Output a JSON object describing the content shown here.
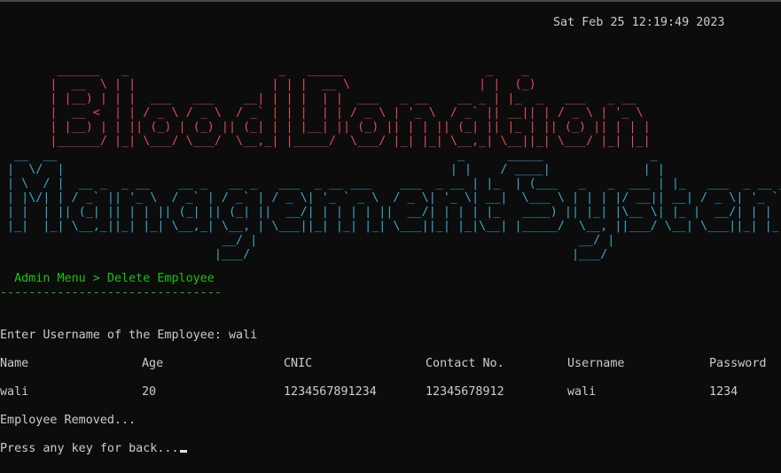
{
  "header": {
    "datetime": "Sat Feb 25 12:19:49 2023"
  },
  "banner": {
    "color_top": "#e74856",
    "color_bottom": "#3aa8c9",
    "art_top": "        ______   _                     _   _____                    _    _\n       |  __  \\ | |                   | | |  __ \\                  | |  (_)\n       | |__) | | |  ___   ___    __| | | |  | |  ___   _ __    __ _ | |_  _   ___   _ __\n       |  __ <  | | / _ \\ / _ \\  / _` | | |  | | / _ \\ | '_ \\  / _` || __|| | / _ \\ | '_ \\\n       | |__) | | || (_) | (_) || (_| | | |__| || (_) || | | || (_| || |_ | || (_) || | | |\n       |______/ |_| \\___/ \\___/  \\__,_| |_____/  \\___/ |_| |_| \\__,_| \\__||_| \\___/ |_| |_|",
    "art_bottom": "  __  __                                                        _      _____               _\n |  \\/  |                                                      | |    / ____|             | |\n | \\  / |  __ _  _ __    __ _   __ _   ___  _ __ ___    ___  _ __ | |_  | (___   _   _  ___ | |_   ___  _ __ ___\n | |\\/| | / _` || '_ \\  / _` | / _` | / _ \\| '_ ` _ \\  / _ \\| '_ \\| __|  \\___ \\ | | | |/ __|| __| / _ \\| '_ ` _ \\\n | |  | || (_| || | | || (_| || (_| ||  __/| | | | | ||  __/| | | | |_   ____) || |_| |\\__ \\| |_ |  __/| | | | | |\n |_|  |_| \\__,_||_| |_| \\__,_| \\__, | \\___||_| |_| |_| \\___||_| |_|\\__| |_____/  \\__, ||___/ \\__| \\___||_| |_| |_|\n                               __/ |                                             __/ |\n                              |___/                                             |___/"
  },
  "menu": {
    "path": "  Admin Menu > Delete Employee",
    "separator": "-------------------------------",
    "color": "#16c60c"
  },
  "prompt": {
    "username_prompt": "Enter Username of the Employee: wali"
  },
  "table": {
    "headers": [
      "Name",
      "Age",
      "CNIC",
      "Contact No.",
      "Username",
      "Password"
    ],
    "rows": [
      [
        "wali",
        "20",
        "1234567891234",
        "12345678912",
        "wali",
        "1234"
      ]
    ]
  },
  "status": {
    "removed": "Employee Removed...",
    "press_key": "Press any key for back..."
  }
}
